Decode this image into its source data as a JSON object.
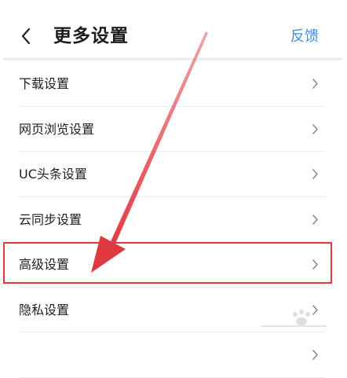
{
  "header": {
    "back_icon": "chevron-left-icon",
    "title": "更多设置",
    "feedback_label": "反馈"
  },
  "settings": {
    "items": [
      {
        "label": "下载设置",
        "icon": "chevron-right-icon"
      },
      {
        "label": "网页浏览设置",
        "icon": "chevron-right-icon"
      },
      {
        "label": "UC头条设置",
        "icon": "chevron-right-icon"
      },
      {
        "label": "云同步设置",
        "icon": "chevron-right-icon"
      },
      {
        "label": "高级设置",
        "icon": "chevron-right-icon",
        "highlighted": true
      },
      {
        "label": "隐私设置",
        "icon": "chevron-right-icon"
      },
      {
        "label": "",
        "icon": "chevron-right-icon"
      }
    ]
  },
  "annotation": {
    "highlight_color": "#e0383f",
    "arrow_color": "#e0383f",
    "watermark_icon": "baidu-paw-icon"
  },
  "colors": {
    "accent": "#3a8fe0",
    "text": "#1e1e1e",
    "divider": "#ececec",
    "chevron": "#8a8a8a"
  }
}
